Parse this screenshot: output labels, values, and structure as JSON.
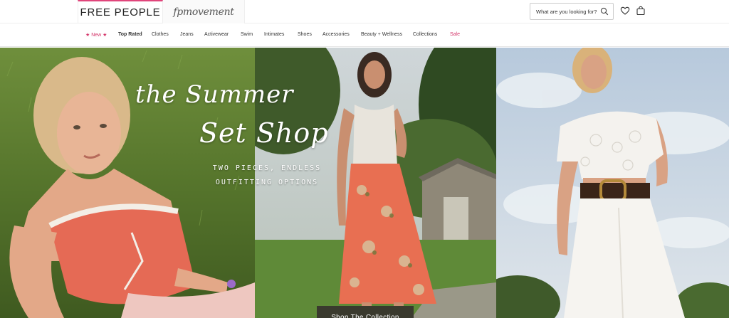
{
  "header": {
    "brand_primary": "FREE PEOPLE",
    "brand_secondary": "fpmovement",
    "search_placeholder": "What are you looking for?",
    "icons": [
      "search-icon",
      "heart-icon",
      "bag-icon"
    ]
  },
  "nav": {
    "items": [
      {
        "label": "★ New ★"
      },
      {
        "label": "Top Rated"
      },
      {
        "label": "Clothes"
      },
      {
        "label": "Jeans"
      },
      {
        "label": "Activewear"
      },
      {
        "label": "Swim"
      },
      {
        "label": "Intimates"
      },
      {
        "label": "Shoes"
      },
      {
        "label": "Accessories"
      },
      {
        "label": "Beauty + Wellness"
      },
      {
        "label": "Collections"
      },
      {
        "label": "Sale"
      }
    ]
  },
  "hero": {
    "title_line1": "the Summer",
    "title_line2": "Set Shop",
    "subtitle": "TWO PIECES, ENDLESS OUTFITTING OPTIONS",
    "cta_label": "Shop The Collection"
  },
  "colors": {
    "accent": "#d4376b",
    "brand_border": "#e0457b",
    "cta_bg": "#3a3a2e"
  }
}
